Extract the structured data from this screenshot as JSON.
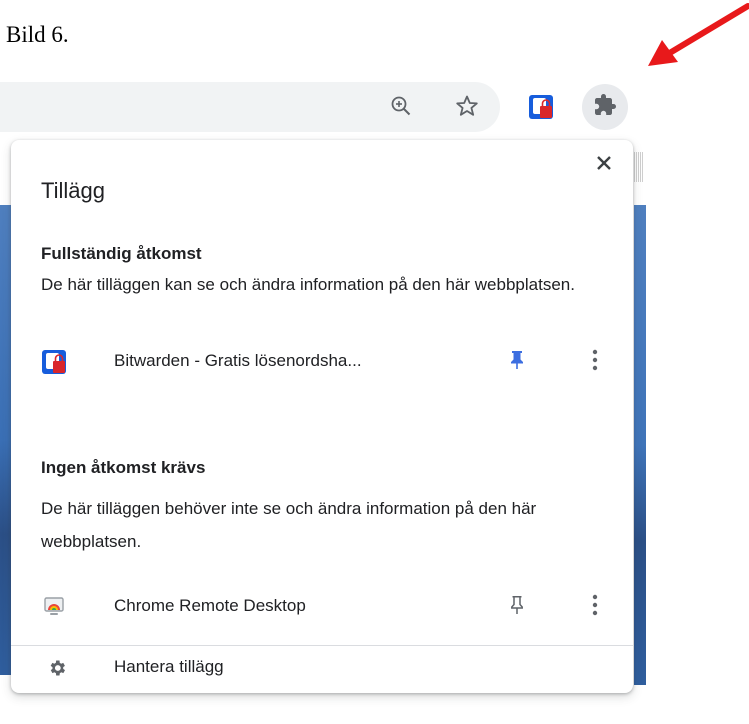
{
  "caption": "Bild 6.",
  "toolbar": {
    "zoom_icon": "zoom-in-icon",
    "bookmark_icon": "star-icon",
    "bitwarden_icon": "bitwarden-icon",
    "extensions_icon": "puzzle-icon"
  },
  "popup": {
    "title": "Tillägg",
    "close_icon": "close-icon",
    "full_access": {
      "heading": "Fullständig åtkomst",
      "description": "De här tilläggen kan se och ändra information på den här webbplatsen.",
      "extensions": [
        {
          "name": "Bitwarden - Gratis lösenordsha...",
          "icon": "bitwarden-icon",
          "pinned": true
        }
      ]
    },
    "no_access": {
      "heading": "Ingen åtkomst krävs",
      "description": "De här tilläggen behöver inte se och ändra information på den här webbplatsen.",
      "extensions": [
        {
          "name": "Chrome Remote Desktop",
          "icon": "remote-desktop-icon",
          "pinned": false
        }
      ]
    },
    "manage": {
      "label": "Hantera tillägg",
      "icon": "gear-icon"
    }
  },
  "colors": {
    "pin_active": "#3c6ee0",
    "pin_inactive": "#5f6368",
    "arrow": "#e8191b",
    "bitwarden_blue": "#175ddc",
    "bitwarden_red": "#d9262b"
  }
}
